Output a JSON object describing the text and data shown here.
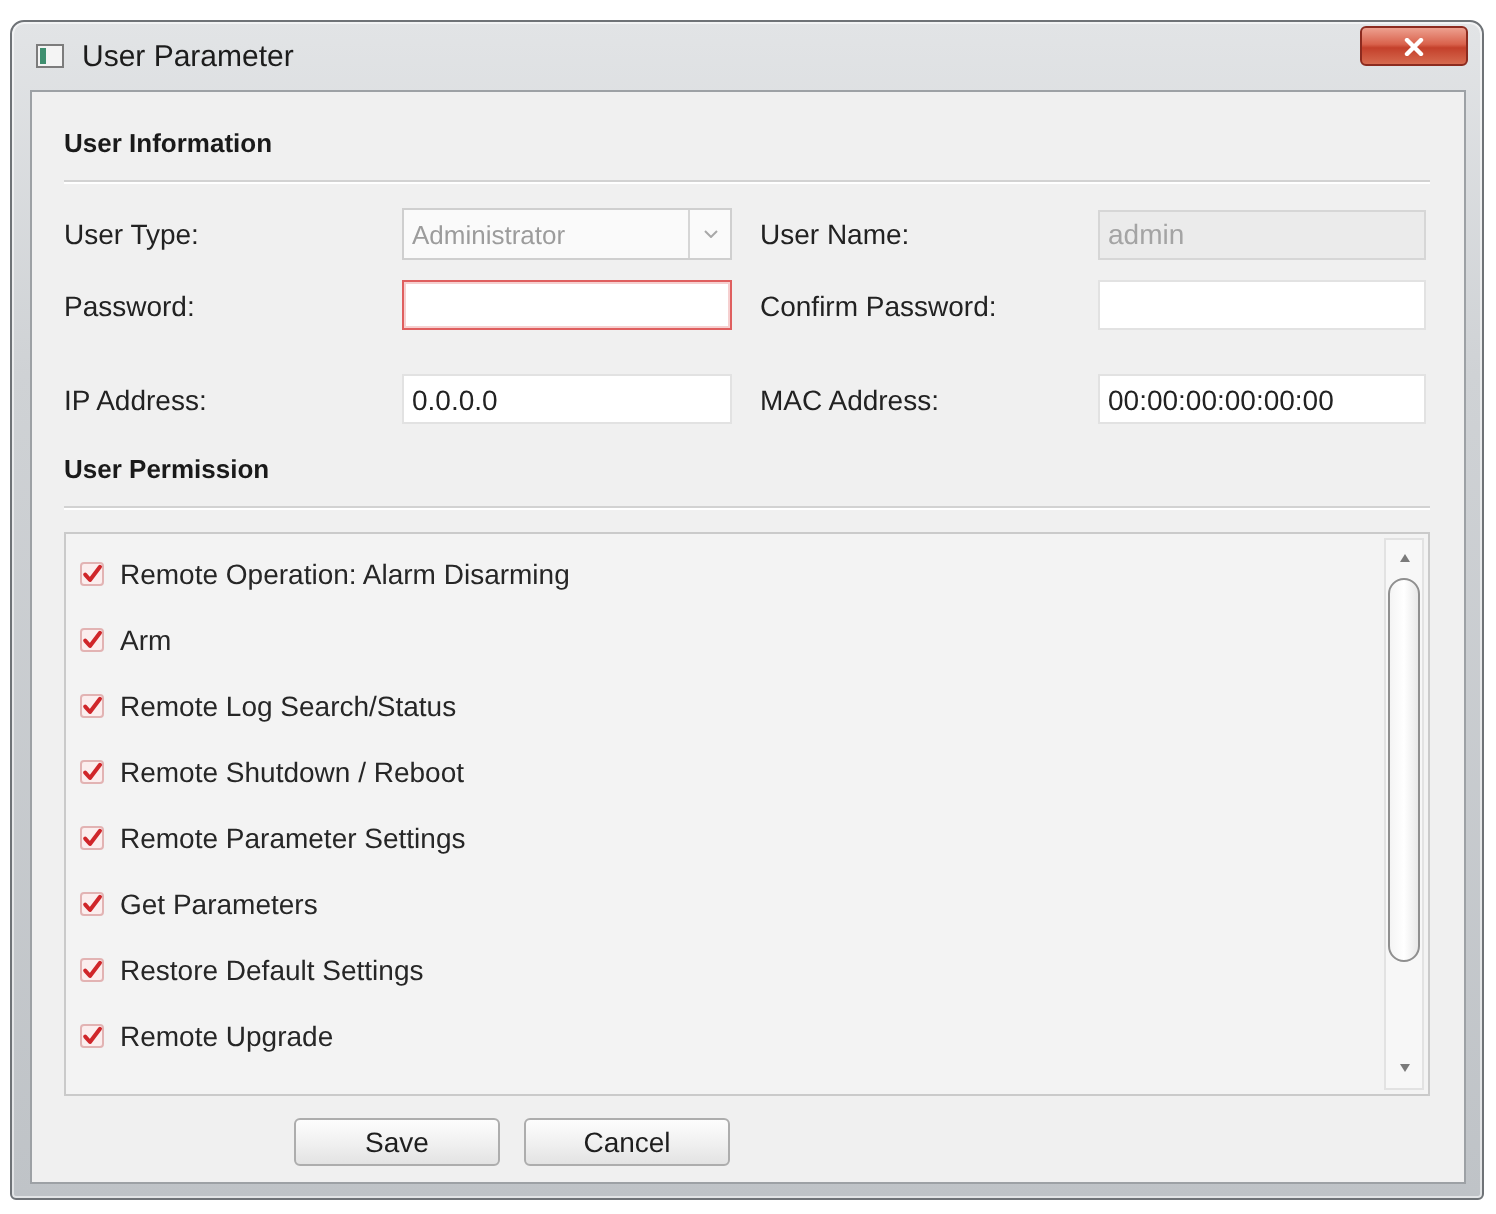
{
  "window": {
    "title": "User Parameter"
  },
  "user_information": {
    "title": "User Information",
    "fields": [
      {
        "label": "User Type:",
        "kind": "dropdown",
        "value": "Administrator",
        "disabled": true,
        "error": false
      },
      {
        "label": "User Name:",
        "kind": "text",
        "value": "admin",
        "disabled": true,
        "error": false
      },
      {
        "label": "Password:",
        "kind": "text",
        "disabled": false,
        "error": true
      },
      {
        "label": "Confirm Password:",
        "kind": "text",
        "disabled": false,
        "error": false
      },
      {
        "label": "IP Address:",
        "kind": "text",
        "value": "0.0.0.0",
        "disabled": false,
        "error": false
      },
      {
        "label": "MAC Address:",
        "kind": "text",
        "value": "00:00:00:00:00:00",
        "disabled": false,
        "error": false
      }
    ]
  },
  "user_permission": {
    "title": "User Permission",
    "items": [
      {
        "label": "Remote Operation: Alarm Disarming",
        "checked": true
      },
      {
        "label": "Arm",
        "checked": true
      },
      {
        "label": "Remote Log Search/Status",
        "checked": true
      },
      {
        "label": "Remote Shutdown / Reboot",
        "checked": true
      },
      {
        "label": "Remote Parameter Settings",
        "checked": true
      },
      {
        "label": "Get Parameters",
        "checked": true
      },
      {
        "label": "Restore Default Settings",
        "checked": true
      },
      {
        "label": "Remote Upgrade",
        "checked": true
      }
    ]
  },
  "buttons": [
    {
      "label": "Save"
    },
    {
      "label": "Cancel"
    }
  ]
}
